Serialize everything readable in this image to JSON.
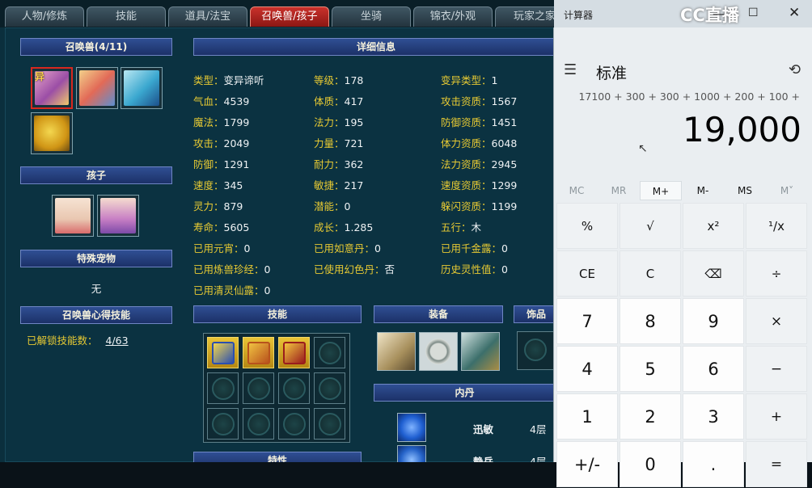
{
  "tabs": [
    "人物/修炼",
    "技能",
    "道具/法宝",
    "召唤兽/孩子",
    "坐骑",
    "锦衣/外观",
    "玩家之家"
  ],
  "active_tab": "召唤兽/孩子",
  "pets_header": "召唤兽(4/11)",
  "pet_badge": "异",
  "child_header": "孩子",
  "special_pet_header": "特殊宠物",
  "special_pet_value": "无",
  "pet_skill_header": "召唤兽心得技能",
  "unlocked_label": "已解锁技能数：",
  "unlocked_value": "4/63",
  "detail_header": "详细信息",
  "details": [
    [
      "类型：",
      "变异谛听"
    ],
    [
      "等级：",
      "178"
    ],
    [
      "变异类型：",
      "1"
    ],
    [
      "气血：",
      "4539"
    ],
    [
      "体质：",
      "417"
    ],
    [
      "攻击资质：",
      "1567"
    ],
    [
      "魔法：",
      "1799"
    ],
    [
      "法力：",
      "195"
    ],
    [
      "防御资质：",
      "1451"
    ],
    [
      "攻击：",
      "2049"
    ],
    [
      "力量：",
      "721"
    ],
    [
      "体力资质：",
      "6048"
    ],
    [
      "防御：",
      "1291"
    ],
    [
      "耐力：",
      "362"
    ],
    [
      "法力资质：",
      "2945"
    ],
    [
      "速度：",
      "345"
    ],
    [
      "敏捷：",
      "217"
    ],
    [
      "速度资质：",
      "1299"
    ],
    [
      "灵力：",
      "879"
    ],
    [
      "潜能：",
      "0"
    ],
    [
      "躲闪资质：",
      "1199"
    ],
    [
      "寿命：",
      "5605"
    ],
    [
      "成长：",
      "1.285"
    ],
    [
      "五行：",
      "木"
    ],
    [
      "已用元宵：",
      "0"
    ],
    [
      "已用如意丹：",
      "0"
    ],
    [
      "已用千金露：",
      "0"
    ],
    [
      "已用炼兽珍经：",
      "0"
    ],
    [
      "已使用幻色丹：",
      "否"
    ],
    [
      "历史灵性值：",
      "0"
    ],
    [
      "已用清灵仙露：",
      "0"
    ]
  ],
  "skills_header": "技能",
  "equip_header": "装备",
  "accessory_header": "饰品",
  "neidan_header": "内丹",
  "neidan": [
    {
      "name": "迅敏",
      "level": "4层"
    },
    {
      "name": "静岳",
      "level": "4层"
    }
  ],
  "traits_header": "特性",
  "watermark": "CC直播",
  "calculator": {
    "title": "计算器",
    "mode": "标准",
    "expression": "17100 + 300 + 300 + 1000 + 200 + 100 +",
    "result": "19,000",
    "memory": [
      "MC",
      "MR",
      "M+",
      "M-",
      "MS",
      "M˅"
    ],
    "keys": [
      [
        "%",
        "√",
        "x²",
        "¹/x"
      ],
      [
        "CE",
        "C",
        "⌫",
        "÷"
      ],
      [
        "7",
        "8",
        "9",
        "×"
      ],
      [
        "4",
        "5",
        "6",
        "−"
      ],
      [
        "1",
        "2",
        "3",
        "+"
      ],
      [
        "+/-",
        "0",
        ".",
        "="
      ]
    ]
  },
  "colors": {
    "active_tab": "#c9312b",
    "header_bar": "#1c3168",
    "label": "#e6c933"
  }
}
